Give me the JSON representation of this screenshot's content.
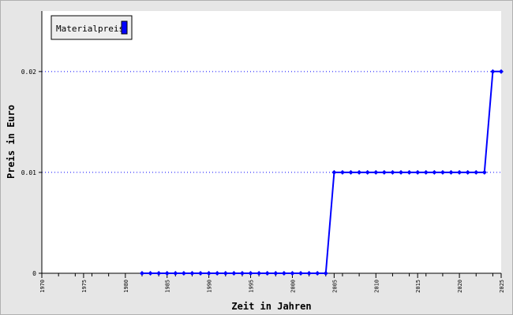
{
  "chart_data": {
    "type": "line",
    "xlabel": "Zeit in Jahren",
    "ylabel": "Preis in Euro",
    "xlim": [
      1970,
      2025
    ],
    "ylim": [
      0,
      0.026
    ],
    "x_ticks": [
      1970,
      1975,
      1980,
      1985,
      1990,
      1995,
      2000,
      2005,
      2010,
      2015,
      2020,
      2025
    ],
    "y_ticks": [
      0,
      0.01,
      0.02
    ],
    "y_tick_labels": [
      "0",
      "0.01",
      "0.02"
    ],
    "grid": "horizontal dotted",
    "legend_position": "top-left",
    "series": [
      {
        "name": "Materialpreis",
        "color": "#0000ff",
        "x": [
          1982,
          1983,
          1984,
          1985,
          1986,
          1987,
          1988,
          1989,
          1990,
          1991,
          1992,
          1993,
          1994,
          1995,
          1996,
          1997,
          1998,
          1999,
          2000,
          2001,
          2002,
          2003,
          2004,
          2005,
          2006,
          2007,
          2008,
          2009,
          2010,
          2011,
          2012,
          2013,
          2014,
          2015,
          2016,
          2017,
          2018,
          2019,
          2020,
          2021,
          2022,
          2023,
          2024,
          2025
        ],
        "values": [
          0,
          0,
          0,
          0,
          0,
          0,
          0,
          0,
          0,
          0,
          0,
          0,
          0,
          0,
          0,
          0,
          0,
          0,
          0,
          0,
          0,
          0,
          0,
          0.01,
          0.01,
          0.01,
          0.01,
          0.01,
          0.01,
          0.01,
          0.01,
          0.01,
          0.01,
          0.01,
          0.01,
          0.01,
          0.01,
          0.01,
          0.01,
          0.01,
          0.01,
          0.01,
          0.02,
          0.02
        ]
      }
    ]
  }
}
